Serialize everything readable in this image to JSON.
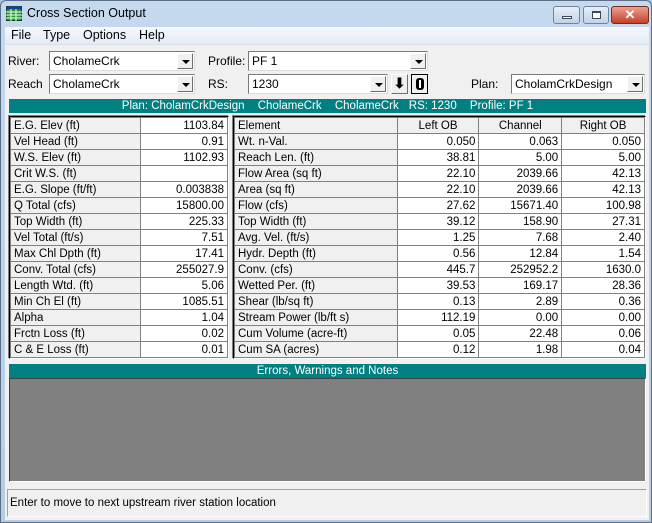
{
  "window": {
    "title": "Cross Section Output",
    "controls": {
      "minimize": "minimize",
      "maximize": "maximize",
      "close": "✕"
    }
  },
  "menu": [
    "File",
    "Type",
    "Options",
    "Help"
  ],
  "selectors": {
    "river_label": "River:",
    "river_value": "CholameCrk",
    "reach_label": "Reach",
    "reach_value": "CholameCrk",
    "profile_label": "Profile:",
    "profile_value": "PF 1",
    "rs_label": "RS:",
    "rs_value": "1230",
    "plan_label": "Plan:",
    "plan_value": "CholamCrkDesign",
    "next_upstream_icon": "down-arrow-icon",
    "bug_icon": "bug-icon"
  },
  "summary_bar": {
    "plan": "Plan: CholamCrkDesign",
    "river": "CholameCrk",
    "reach": "CholameCrk",
    "rs": "RS: 1230",
    "profile": "Profile: PF 1"
  },
  "left_table": [
    {
      "label": "E.G. Elev (ft)",
      "value": "1103.84"
    },
    {
      "label": "Vel Head (ft)",
      "value": "0.91"
    },
    {
      "label": "W.S. Elev (ft)",
      "value": "1102.93"
    },
    {
      "label": "Crit W.S. (ft)",
      "value": ""
    },
    {
      "label": "E.G. Slope (ft/ft)",
      "value": "0.003838"
    },
    {
      "label": "Q Total (cfs)",
      "value": "15800.00"
    },
    {
      "label": "Top Width (ft)",
      "value": "225.33"
    },
    {
      "label": "Vel Total (ft/s)",
      "value": "7.51"
    },
    {
      "label": "Max Chl Dpth (ft)",
      "value": "17.41"
    },
    {
      "label": "Conv. Total (cfs)",
      "value": "255027.9"
    },
    {
      "label": "Length Wtd. (ft)",
      "value": "5.06"
    },
    {
      "label": "Min Ch El (ft)",
      "value": "1085.51"
    },
    {
      "label": "Alpha",
      "value": "1.04"
    },
    {
      "label": "Frctn Loss (ft)",
      "value": "0.02"
    },
    {
      "label": "C & E Loss (ft)",
      "value": "0.01"
    }
  ],
  "right_table": {
    "headers": [
      "Element",
      "Left OB",
      "Channel",
      "Right OB"
    ],
    "rows": [
      {
        "label": "Wt. n-Val.",
        "left": "0.050",
        "channel": "0.063",
        "right": "0.050"
      },
      {
        "label": "Reach Len. (ft)",
        "left": "38.81",
        "channel": "5.00",
        "right": "5.00"
      },
      {
        "label": "Flow Area (sq ft)",
        "left": "22.10",
        "channel": "2039.66",
        "right": "42.13"
      },
      {
        "label": "Area (sq ft)",
        "left": "22.10",
        "channel": "2039.66",
        "right": "42.13"
      },
      {
        "label": "Flow (cfs)",
        "left": "27.62",
        "channel": "15671.40",
        "right": "100.98"
      },
      {
        "label": "Top Width (ft)",
        "left": "39.12",
        "channel": "158.90",
        "right": "27.31"
      },
      {
        "label": "Avg. Vel. (ft/s)",
        "left": "1.25",
        "channel": "7.68",
        "right": "2.40"
      },
      {
        "label": "Hydr. Depth (ft)",
        "left": "0.56",
        "channel": "12.84",
        "right": "1.54"
      },
      {
        "label": "Conv. (cfs)",
        "left": "445.7",
        "channel": "252952.2",
        "right": "1630.0"
      },
      {
        "label": "Wetted Per. (ft)",
        "left": "39.53",
        "channel": "169.17",
        "right": "28.36"
      },
      {
        "label": "Shear (lb/sq ft)",
        "left": "0.13",
        "channel": "2.89",
        "right": "0.36"
      },
      {
        "label": "Stream Power (lb/ft s)",
        "left": "112.19",
        "channel": "0.00",
        "right": "0.00"
      },
      {
        "label": "Cum Volume (acre-ft)",
        "left": "0.05",
        "channel": "22.48",
        "right": "0.06"
      },
      {
        "label": "Cum SA (acres)",
        "left": "0.12",
        "channel": "1.98",
        "right": "0.04"
      }
    ]
  },
  "notes": {
    "title": "Errors, Warnings and Notes",
    "content": ""
  },
  "status_bar": "Enter to move to next upstream river station location",
  "colors": {
    "header_teal": "#008080",
    "notes_bg": "#808080"
  }
}
